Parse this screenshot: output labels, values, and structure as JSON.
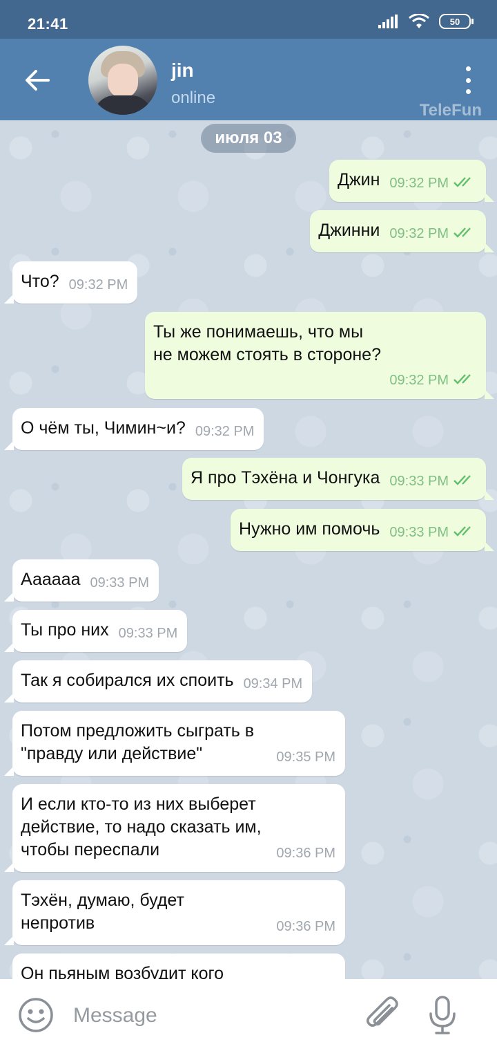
{
  "status_bar": {
    "time": "21:41",
    "battery": "50",
    "icons": [
      "signal-icon",
      "wifi-icon",
      "battery-icon"
    ]
  },
  "header": {
    "contact_name": "jin",
    "contact_status": "online",
    "watermark": "TeleFun"
  },
  "chat": {
    "date_label": "июля 03",
    "messages": [
      {
        "dir": "out",
        "text": "Джин",
        "time": "09:32 PM",
        "read": true
      },
      {
        "dir": "out",
        "text": "Джинни",
        "time": "09:32 PM",
        "read": true
      },
      {
        "dir": "in",
        "text": "Что?",
        "time": "09:32 PM"
      },
      {
        "dir": "out",
        "text": "Ты же понимаешь, что мы\nне можем стоять в стороне?",
        "time": "09:32 PM",
        "read": true
      },
      {
        "dir": "in",
        "text": "О чём ты, Чимин~и?",
        "time": "09:32 PM"
      },
      {
        "dir": "out",
        "text": "Я про Тэхёна и Чонгука",
        "time": "09:33 PM",
        "read": true
      },
      {
        "dir": "out",
        "text": "Нужно им помочь",
        "time": "09:33 PM",
        "read": true
      },
      {
        "dir": "in",
        "text": "Аааааа",
        "time": "09:33 PM"
      },
      {
        "dir": "in",
        "text": "Ты про них",
        "time": "09:33 PM"
      },
      {
        "dir": "in",
        "text": "Так я собирался их споить",
        "time": "09:34 PM"
      },
      {
        "dir": "in",
        "text": "Потом предложить сыграть в\n\"правду или действие\"",
        "time": "09:35 PM"
      },
      {
        "dir": "in",
        "text": "И если кто-то из них выберет\nдействие, то надо сказать им,\nчтобы переспали",
        "time": "09:36 PM"
      },
      {
        "dir": "in",
        "text": "Тэхён, думаю, будет\nнепротив",
        "time": "09:36 PM"
      },
      {
        "dir": "in",
        "text": "Он пьяным возбудит кого",
        "time": ""
      }
    ]
  },
  "input": {
    "placeholder": "Message"
  },
  "colors": {
    "header": "#5281b0",
    "status_bar": "#43688f",
    "outgoing_bubble": "#effdde",
    "incoming_bubble": "#ffffff",
    "read_check": "#5fbf6a"
  }
}
